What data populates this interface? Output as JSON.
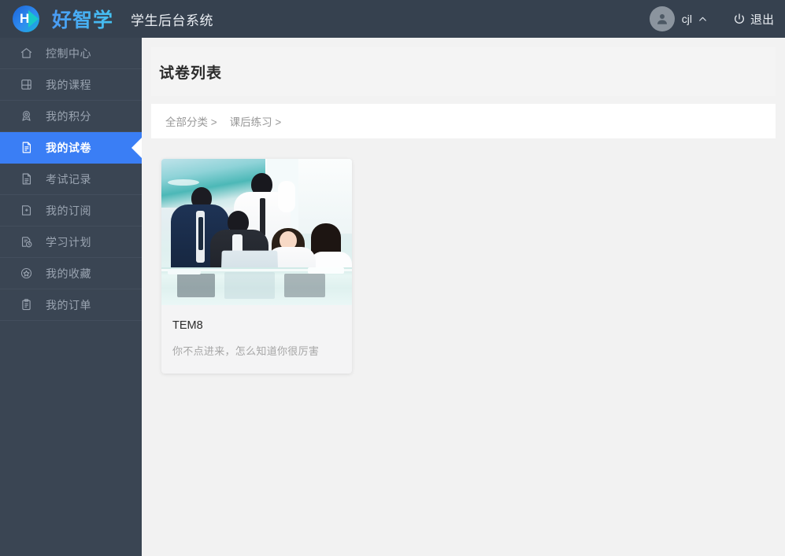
{
  "topbar": {
    "logo_letter": "H",
    "logo_text": "好智学",
    "system_title": "学生后台系统",
    "user_name": "cjl",
    "logout_label": "退出",
    "avatar_icon": "user-avatar-icon",
    "chevron_icon": "chevron-up-icon",
    "power_icon": "power-icon",
    "bg_color": "#36414f"
  },
  "sidebar": {
    "bg_color": "#3a4553",
    "active_color": "#3a7ef5",
    "items": [
      {
        "label": "控制中心",
        "icon": "home-icon",
        "active": false
      },
      {
        "label": "我的课程",
        "icon": "book-icon",
        "active": false
      },
      {
        "label": "我的积分",
        "icon": "medal-icon",
        "active": false
      },
      {
        "label": "我的试卷",
        "icon": "paper-pen-icon",
        "active": true
      },
      {
        "label": "考试记录",
        "icon": "document-lines-icon",
        "active": false
      },
      {
        "label": "我的订阅",
        "icon": "folder-plus-icon",
        "active": false
      },
      {
        "label": "学习计划",
        "icon": "document-clock-icon",
        "active": false
      },
      {
        "label": "我的收藏",
        "icon": "star-circle-icon",
        "active": false
      },
      {
        "label": "我的订单",
        "icon": "clipboard-icon",
        "active": false
      }
    ]
  },
  "main": {
    "page_title": "试卷列表",
    "breadcrumb": [
      "全部分类 >",
      "课后练习 >"
    ],
    "cards": [
      {
        "title": "TEM8",
        "description": "你不点进来，怎么知道你很厉害",
        "image_alt": "business-team-celebrating-photo"
      }
    ]
  }
}
